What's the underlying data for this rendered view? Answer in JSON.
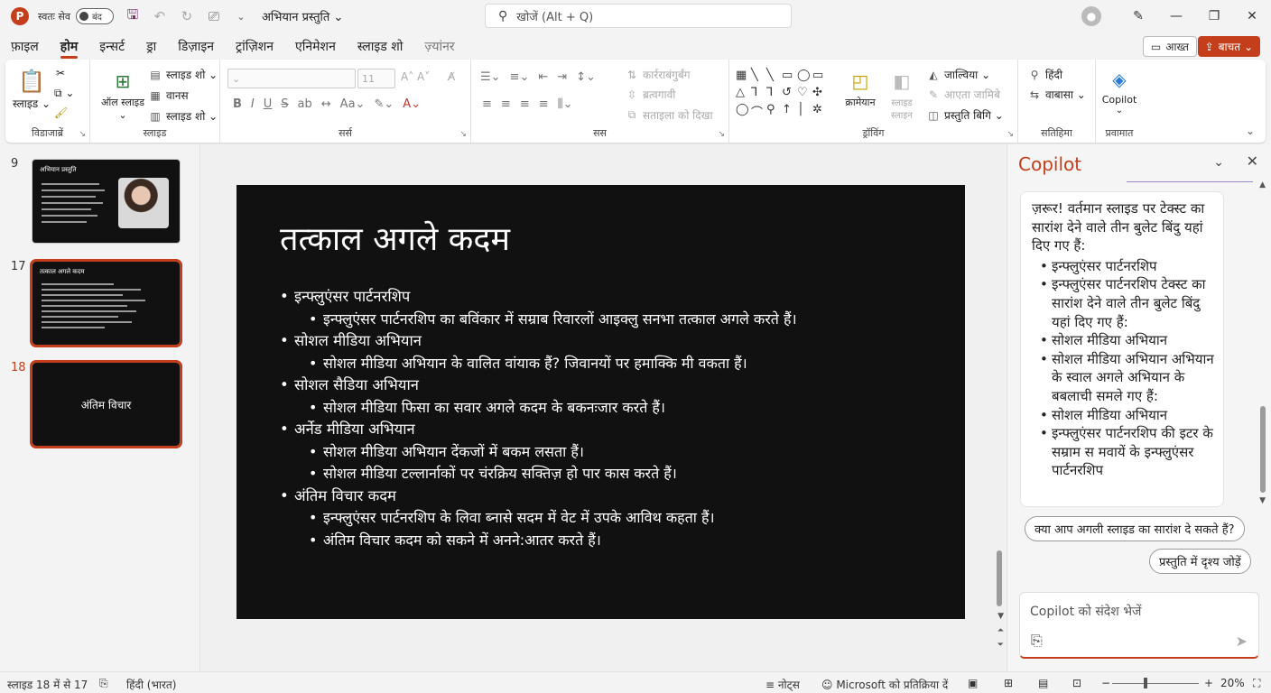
{
  "titlebar": {
    "app_logo": "P",
    "autosave_label": "स्वतः सेव",
    "autosave_state": "बंद",
    "doc_title": "अभियान प्रस्तुति ⌄",
    "search_placeholder": "खोजें (Alt + Q)"
  },
  "tabs": [
    "फ़ाइल",
    "होम",
    "इन्सर्ट",
    "ड्रा",
    "डिज़ाइन",
    "ट्रांज़िशन",
    "एनिमेशन",
    "स्लाइड शो",
    "ज़्यांनर"
  ],
  "header_buttons": {
    "comment": "आख्त",
    "share": "बाचत ⌄"
  },
  "ribbon": {
    "clipboard": {
      "label": "विडाजाब्रें",
      "paste": "स्लाइड ⌄"
    },
    "slides": {
      "label": "स्लाइड",
      "new_slide": "ऑल स्लाइड ⌄",
      "layout": "स्लाइड शो ⌄",
      "reset": "वानस",
      "section": "स्लाइड शो ⌄"
    },
    "font": {
      "label": "सर्स",
      "font_size": "11"
    },
    "paragraph": {
      "label": "सस",
      "text_direction": "कार्रराबंगुर्बंग",
      "align_text": "ब्रत्वगावी",
      "smartart": "सताइला को दिखा"
    },
    "drawing": {
      "label": "ड्रॉविंग",
      "arrange": "क्रामेयान",
      "quick_styles": "स्लाइड स्लाइन",
      "shape_fill": "जाल्विया ⌄",
      "shape_outline": "आएता जामिबे",
      "shape_effects": "प्रस्तुति बिगि ⌄"
    },
    "editing": {
      "label": "सतिहिमा",
      "find": "हिंदी",
      "replace": "वाबासा ⌄"
    },
    "copilot_group": {
      "label": "प्रवामात",
      "button": "Copilot"
    }
  },
  "thumbnails": [
    {
      "number": "9",
      "title": "अभियान प्रस्तुति",
      "selected": false
    },
    {
      "number": "17",
      "title": "तत्काल अगले कदम",
      "selected": true
    },
    {
      "number": "18",
      "title": "अंतिम विचार",
      "selected": true
    }
  ],
  "slide": {
    "title": "तत्काल अगले कदम",
    "bullets": [
      {
        "text": "इन्फ्लुएंसर पार्टनरशिप",
        "subs": [
          "इन्फ्लुएंसर पार्टनरशिप का बविंकार में सम्राब रिवारलों आइक्लु सनभा तत्काल अगले करते हैं।"
        ]
      },
      {
        "text": "सोशल मीडिया अभियान",
        "subs": [
          "सोशल मीडिया अभियान के वालित वांयाक हैं? जिवानयों पर हमाक्कि मी वकता हैं।"
        ]
      },
      {
        "text": "सोशल सैडिया अभियान",
        "subs": [
          "सोशल मीडिया फिसा का सवार अगले कदम के बकनःजार करते हैं।"
        ]
      },
      {
        "text": "अर्नेड मीडिया अभियान",
        "subs": [
          "सोशल मीडिया अभियान देंकजों में बकम लसता हैं।",
          "सोशल मीडिया टल्लार्नाकों पर चंरक्रिय सक्तिज़ हो पार कास करते हैं।"
        ]
      },
      {
        "text": "अंतिम विचार कदम",
        "subs": [
          "इन्फ्लुएंसर पार्टनरशिप के लिवा ब्नासे सदम में वेट में उपके आविथ कहता हैं।",
          "अंतिम विचार कदम को सकने में अनने:आतर करते हैं।"
        ]
      }
    ]
  },
  "copilot": {
    "title": "Copilot",
    "response_intro": "ज़रूर! वर्तमान स्लाइड पर टेक्स्ट का सारांश देने वाले तीन बुलेट बिंदु यहां दिए गए हैं:",
    "response_items": [
      "इन्फ्लुएंसर पार्टनरशिप",
      "इन्फ्लुएंसर पार्टनरशिप टेक्स्ट का सारांश देने वाले तीन बुलेट बिंदु यहां दिए गए हैं:",
      "सोशल मीडिया अभियान",
      "सोशल मीडिया अभियान अभियान के स्वाल अगले अभियान के बबलाची समले गए हैं:",
      "सोशल मीडिया अभियान",
      "इन्फ्लुएंसर पार्टनरशिप की इटर के सम्राम स मवायें के इन्फ्लुएंसर पार्टनरशिप"
    ],
    "suggestions": [
      "क्या आप अगली स्लाइड का सारांश दे सकते हैं?",
      "प्रस्तुति में दृश्य जोड़ें"
    ],
    "input_placeholder": "Copilot को संदेश भेजें"
  },
  "statusbar": {
    "slide_count": "स्लाइड 18 में से 17",
    "language": "हिंदी (भारत)",
    "notes": "नोट्स",
    "feedback": "Microsoft को प्रतिक्रिया दें",
    "zoom": "20%"
  },
  "colors": {
    "accent": "#c43e1c",
    "slide_bg": "#111111",
    "app_bg": "#f3f3f3"
  }
}
